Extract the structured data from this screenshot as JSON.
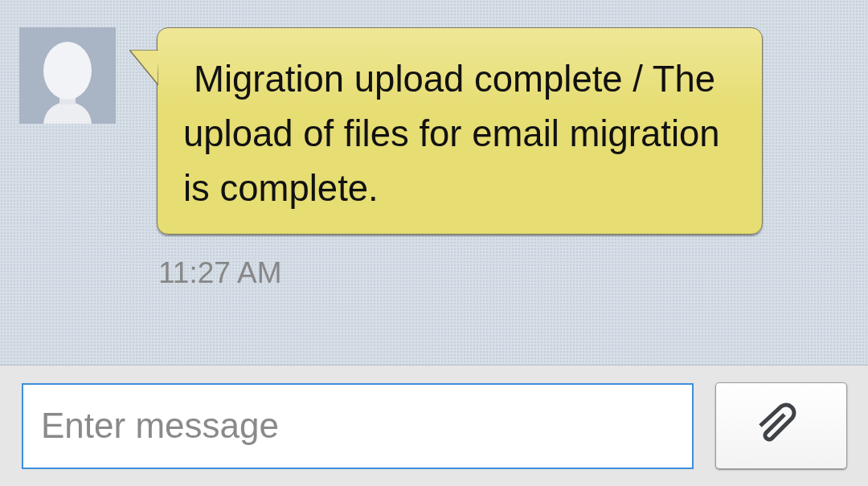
{
  "conversation": {
    "messages": [
      {
        "text": "Migration upload complete / The upload of files for email migration is complete.",
        "time": "11:27 AM"
      }
    ]
  },
  "composer": {
    "placeholder": "Enter message"
  }
}
